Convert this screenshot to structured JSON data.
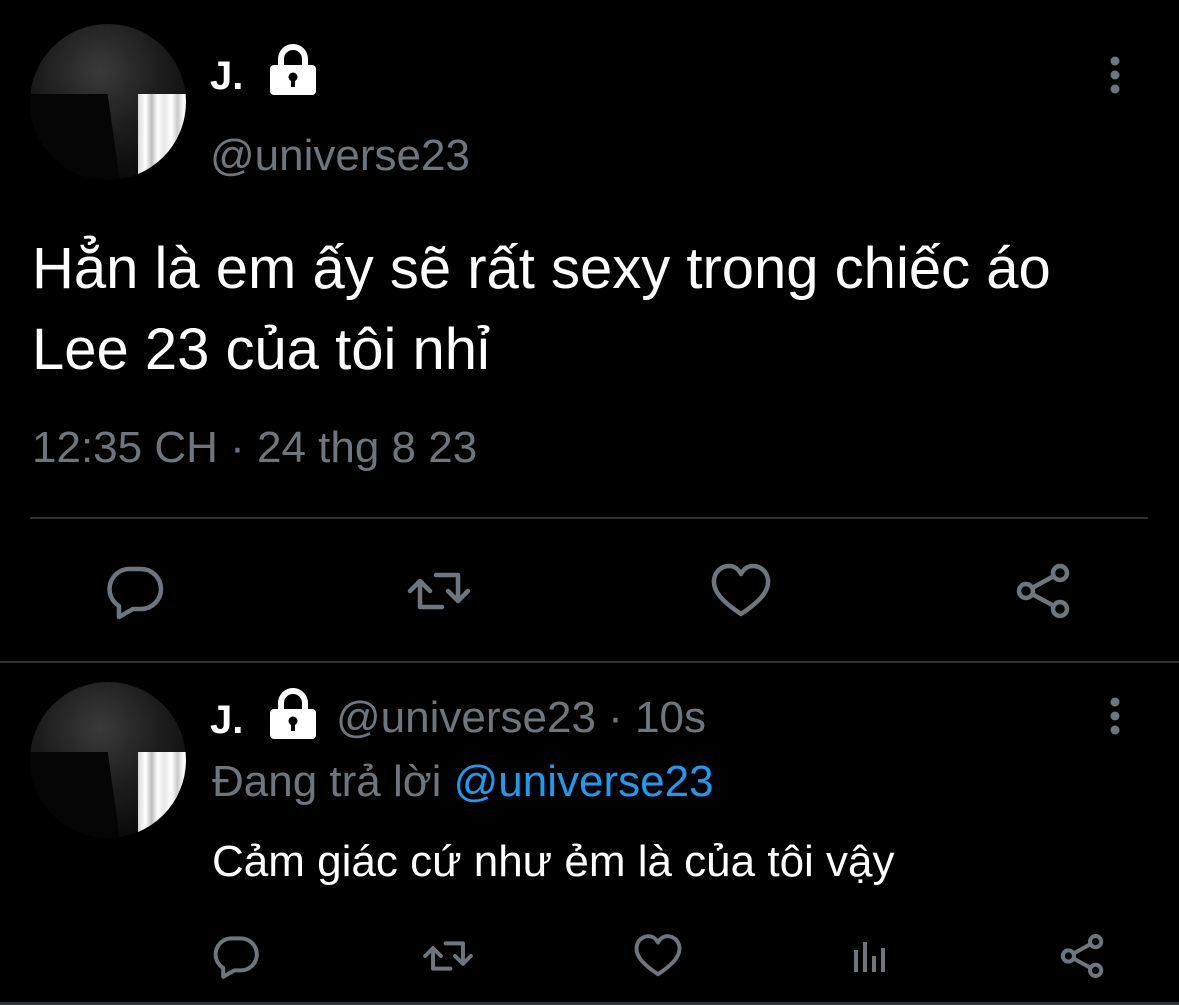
{
  "colors": {
    "background": "#000000",
    "text_primary": "#ffffff",
    "text_secondary": "#6e767d",
    "link": "#1d9bf0",
    "divider": "#2f3336"
  },
  "main_tweet": {
    "display_name": "J.",
    "handle": "@universe23",
    "text": "Hẳn là em ấy sẽ rất sexy trong chiếc áo Lee 23 của tôi nhỉ",
    "timestamp": "12:35 CH · 24 thg 8 23",
    "actions": [
      "reply-icon",
      "retweet-icon",
      "like-icon",
      "share-icon"
    ]
  },
  "reply_tweet": {
    "display_name": "J.",
    "meta": "@universe23 · 10s",
    "replying_label": "Đang trả lời ",
    "replying_mention": "@universe23",
    "text": "Cảm giác cứ như ẻm là của tôi vậy",
    "actions": [
      "reply-icon",
      "retweet-icon",
      "like-icon",
      "analytics-icon",
      "share-icon"
    ]
  }
}
